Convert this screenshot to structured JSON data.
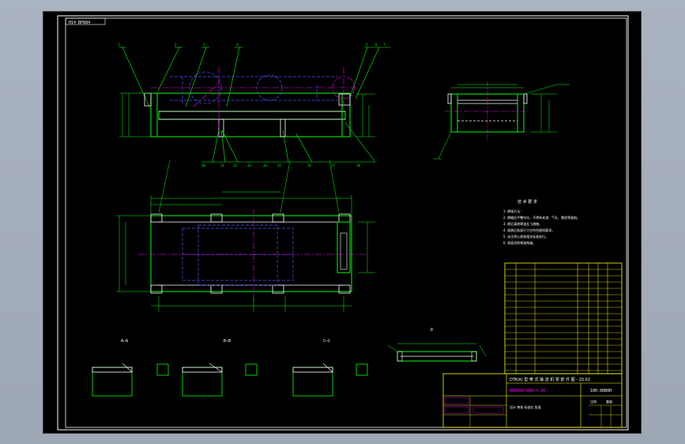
{
  "drawing": {
    "corner_tag": "H14 BP884",
    "sheet_colors": {
      "background": "#000000",
      "frame": "#ffffff",
      "outline": "#00ff00",
      "dimension": "#00ff00",
      "hidden": "#5050ff",
      "center": "#ff00ff",
      "text": "#ffffff"
    },
    "notes": {
      "title": "技 术 要 求",
      "lines": [
        "1. 焊接方法：",
        "2. 焊缝应平整均匀，不得有夹渣、气孔、裂纹等缺陷。",
        "3. 焊后清除焊渣及飞溅物。",
        "4. 组装后各部尺寸应符合图纸要求。",
        "5. 未注明公差按相关标准执行。",
        "6. 表面涂防锈漆两遍。"
      ]
    },
    "views": {
      "section_a": "A—A",
      "section_b": "B—B",
      "section_c": "C—C",
      "view_d": "D"
    },
    "title_block": {
      "drawing_no": "DTⅡ(A) 型 带 式 输 送 机 零 部 件 图 - 20.02",
      "spec": "BH800D×800×4.30",
      "part_code": "100.06B0H",
      "company": "设计 审核 标准化 批准",
      "scale_label": "比例",
      "weight_label": "重量"
    }
  }
}
